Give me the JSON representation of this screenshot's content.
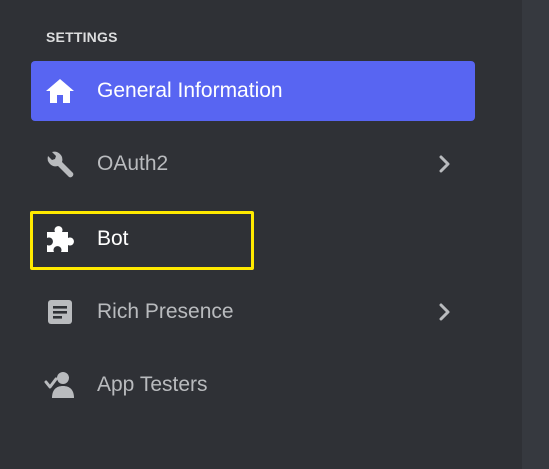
{
  "sidebar": {
    "section_title": "SETTINGS",
    "items": [
      {
        "label": "General Information",
        "icon": "home-icon",
        "active": true
      },
      {
        "label": "OAuth2",
        "icon": "wrench-icon",
        "has_submenu": true
      },
      {
        "label": "Bot",
        "icon": "puzzle-piece-icon",
        "highlighted": true
      },
      {
        "label": "Rich Presence",
        "icon": "document-icon",
        "has_submenu": true
      },
      {
        "label": "App Testers",
        "icon": "user-check-icon"
      }
    ]
  },
  "colors": {
    "background": "#2f3136",
    "active_item": "#5865f2",
    "muted_text": "#b9bbbe",
    "highlight_annotation": "#ffea00"
  }
}
